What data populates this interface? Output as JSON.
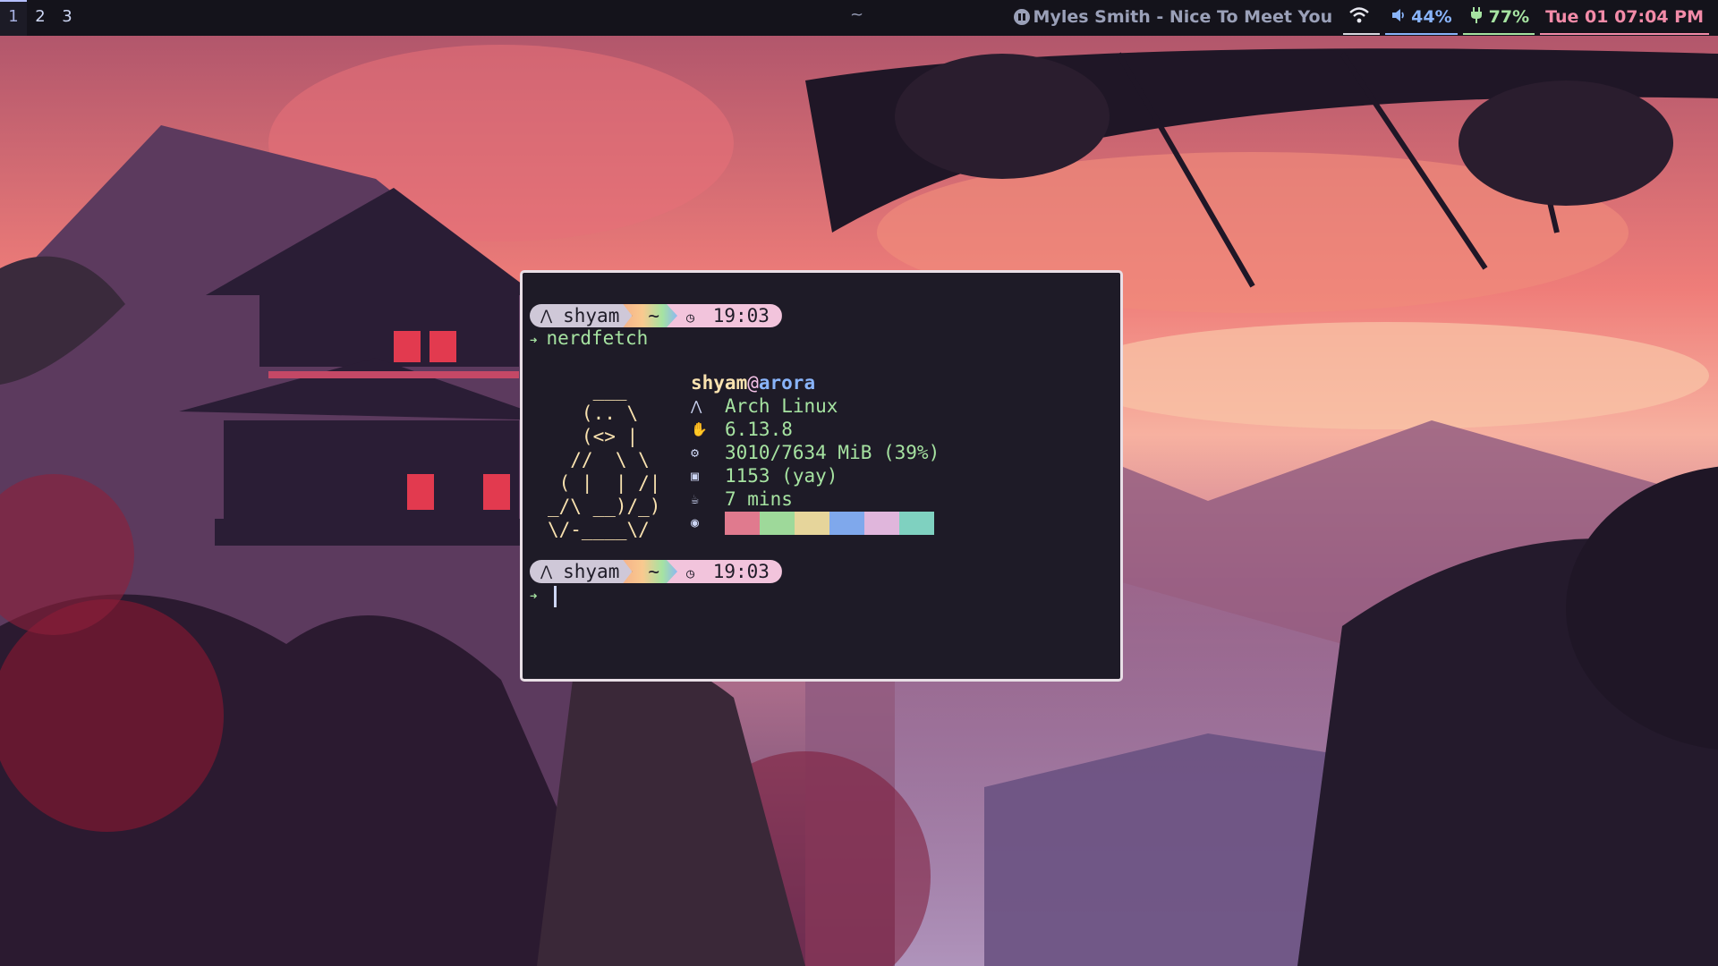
{
  "topbar": {
    "workspaces": [
      "1",
      "2",
      "3"
    ],
    "active_workspace": "1",
    "window_title": "~",
    "media": "Myles Smith - Nice To Meet You",
    "volume": "44%",
    "battery": "77%",
    "clock": "Tue 01 07:04 PM"
  },
  "terminal": {
    "prompt1": {
      "user": "shyam",
      "dir": "~",
      "time": "19:03"
    },
    "command": "nerdfetch",
    "ascii_art": "    ___\n   (.. \\\n   (<> |\n  //  \\ \\\n ( |  | /|\n_/\\ __)/_)\n\\/-____\\/",
    "fetch": {
      "user": "shyam",
      "at": "@",
      "host": "arora",
      "os": "Arch Linux",
      "kernel": "6.13.8",
      "memory": "3010/7634 MiB (39%)",
      "packages": "1153 (yay)",
      "uptime": "7 mins"
    },
    "palette_colors": [
      "#e07a8e",
      "#9ed99a",
      "#e6d59b",
      "#7fa8ec",
      "#e0b6dc",
      "#7fd1c0"
    ],
    "prompt2": {
      "user": "shyam",
      "dir": "~",
      "time": "19:03"
    }
  },
  "icons": {
    "media": "pause-circle-icon",
    "wifi": "wifi-icon",
    "volume": "speaker-icon",
    "battery": "battery-plug-icon",
    "os": "arch-icon",
    "kernel": "tux-icon",
    "memory": "chip-icon",
    "packages": "package-icon",
    "uptime": "coffee-icon",
    "palette": "palette-icon"
  }
}
